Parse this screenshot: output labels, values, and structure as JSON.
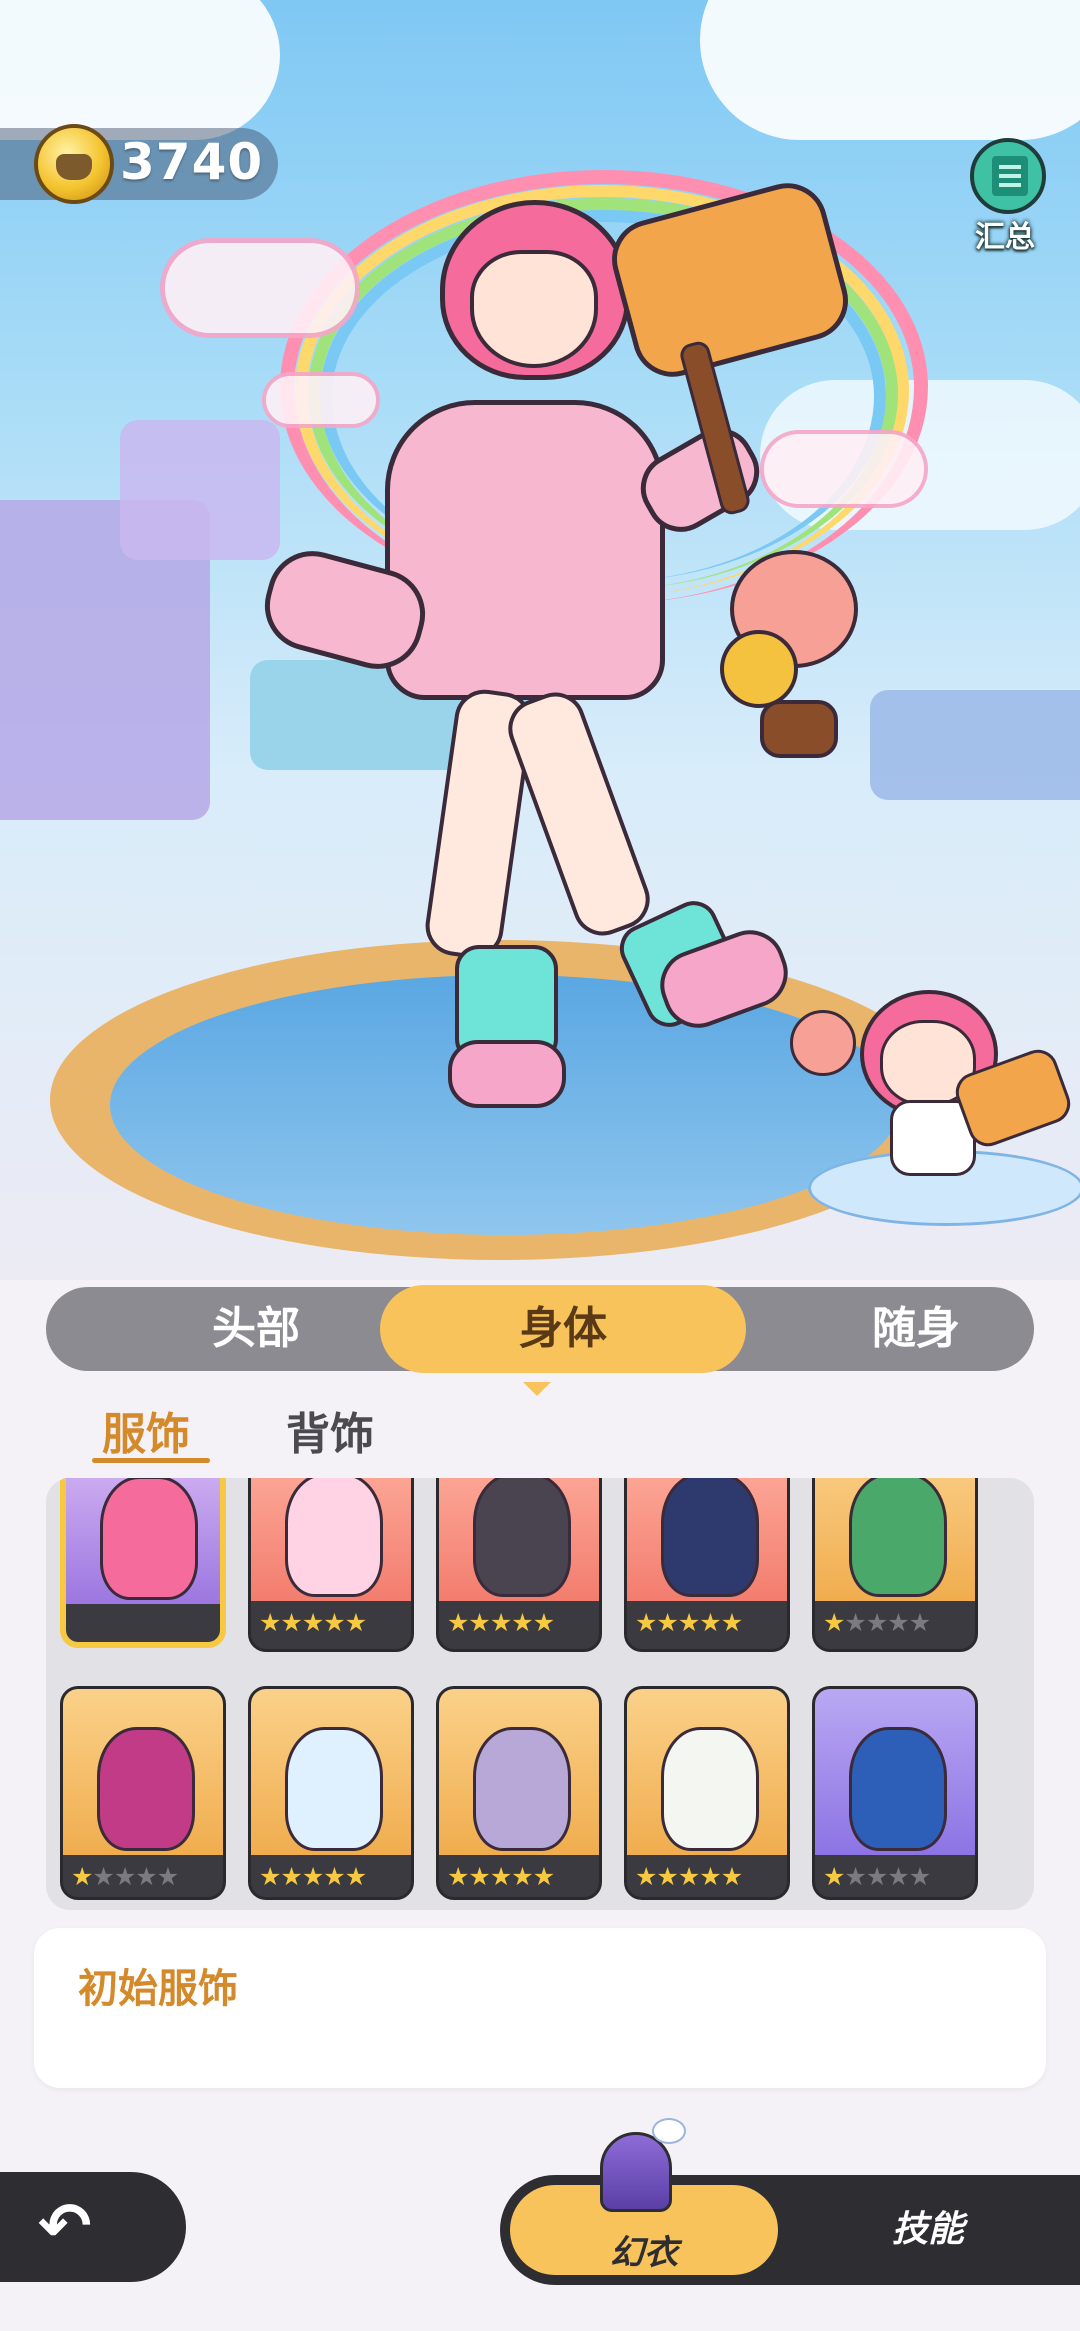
{
  "currency": {
    "icon": "coin-icon",
    "amount": "3740"
  },
  "summary": {
    "icon": "summary-icon",
    "label": "汇总"
  },
  "category_tabs": [
    {
      "label": "头部",
      "selected": false
    },
    {
      "label": "身体",
      "selected": true
    },
    {
      "label": "随身",
      "selected": false
    }
  ],
  "sub_tabs": [
    {
      "label": "服饰",
      "selected": true
    },
    {
      "label": "背饰",
      "selected": false
    }
  ],
  "items": [
    {
      "rarity": 0,
      "selected": true,
      "background": "default"
    },
    {
      "rarity": 5,
      "selected": false,
      "background": "salmon"
    },
    {
      "rarity": 5,
      "selected": false,
      "background": "salmon"
    },
    {
      "rarity": 5,
      "selected": false,
      "background": "salmon"
    },
    {
      "rarity": 1,
      "selected": false,
      "background": "gold"
    },
    {
      "rarity": 1,
      "selected": false,
      "background": "gold"
    },
    {
      "rarity": 5,
      "selected": false,
      "background": "gold"
    },
    {
      "rarity": 5,
      "selected": false,
      "background": "gold"
    },
    {
      "rarity": 5,
      "selected": false,
      "background": "gold"
    },
    {
      "rarity": 1,
      "selected": false,
      "background": "purple"
    }
  ],
  "selected_item": {
    "name": "初始服饰"
  },
  "bottom_nav": {
    "back_icon": "back-arrow-icon",
    "outfit_label": "幻衣",
    "skill_label": "技能"
  },
  "colors": {
    "accent": "#f7c35a",
    "highlight_text": "#d4892a",
    "dark_bar": "#2d2d32"
  }
}
